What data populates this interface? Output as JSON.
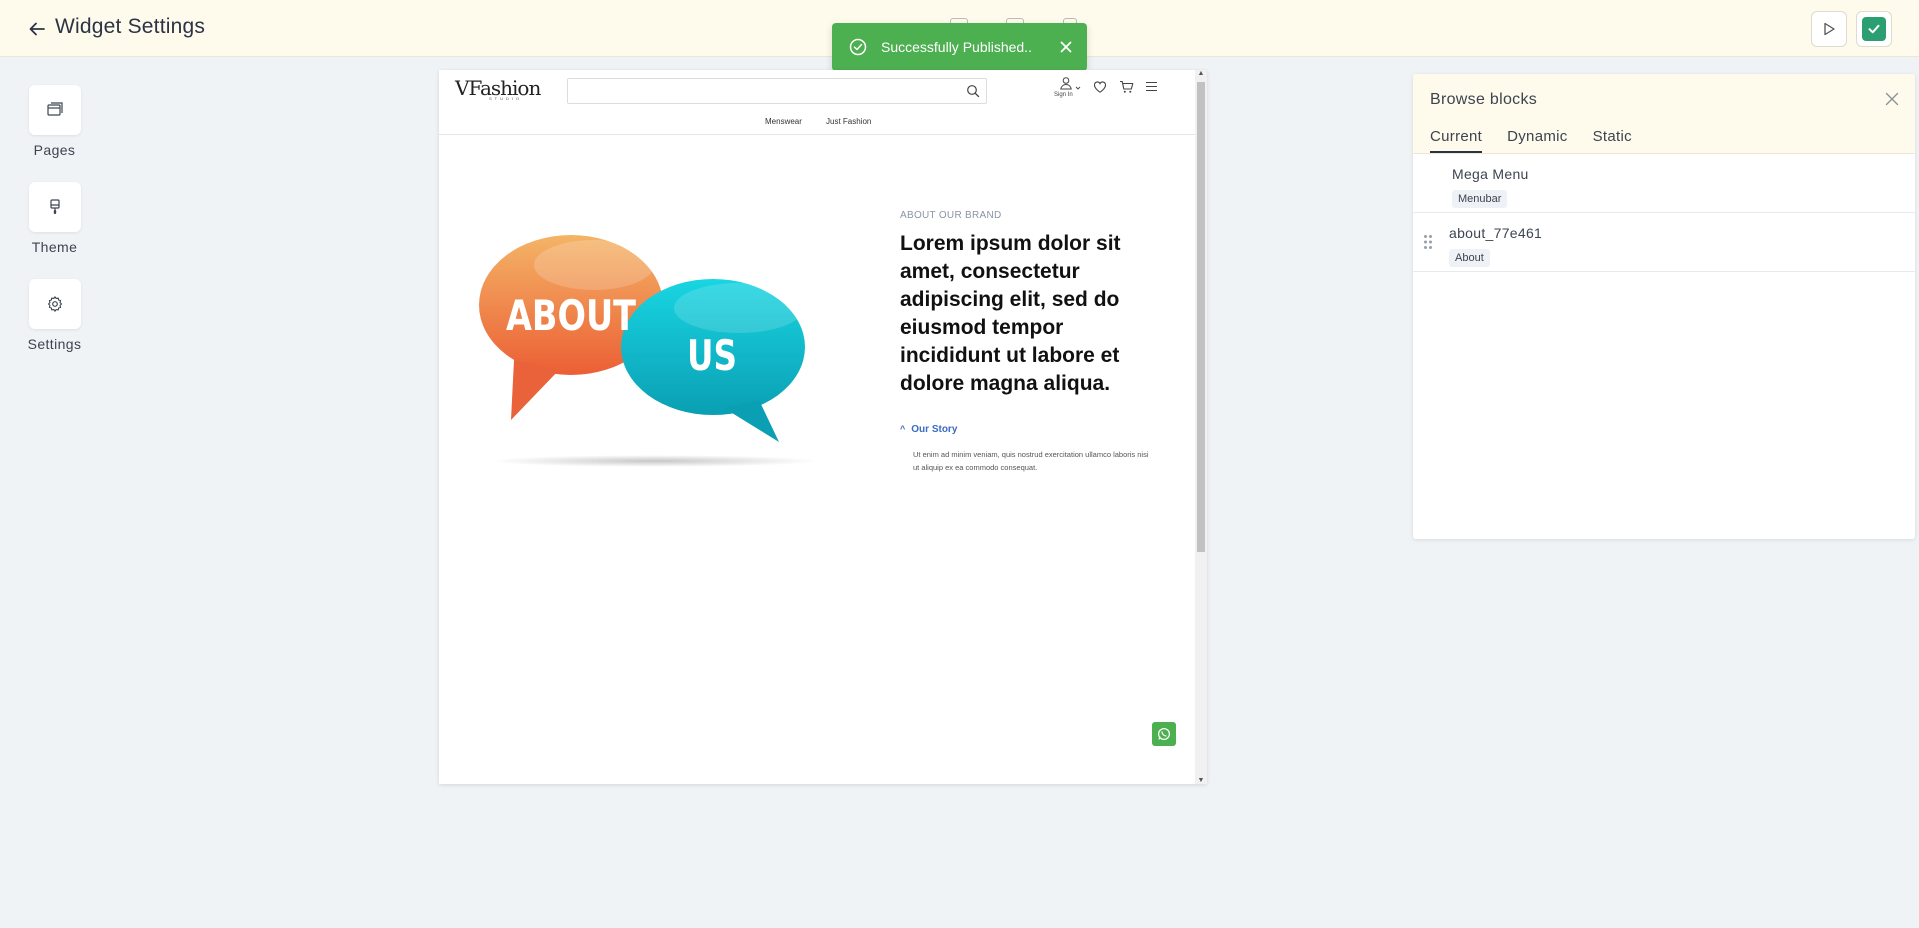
{
  "header": {
    "title": "Widget Settings"
  },
  "toast": {
    "message": "Successfully Published.."
  },
  "sidebar": {
    "items": [
      {
        "label": "Pages",
        "icon": "pages-icon"
      },
      {
        "label": "Theme",
        "icon": "brush-icon"
      },
      {
        "label": "Settings",
        "icon": "gear-icon"
      }
    ]
  },
  "preview": {
    "logo": "VFashion",
    "logo_sub": "STUDIO",
    "signin": "Sign In",
    "menu": [
      "Menswear",
      "Just Fashion"
    ],
    "about_image": {
      "word1": "ABOUT",
      "word2": "US"
    },
    "eyebrow": "ABOUT OUR BRAND",
    "heading": "Lorem ipsum dolor sit amet, consectetur adipiscing elit, sed do eiusmod tempor incididunt ut labore et dolore magna aliqua.",
    "story_title": "Our Story",
    "story_text": "Ut enim ad minim veniam, quis nostrud exercitation ullamco laboris nisi ut aliquip ex ea commodo consequat."
  },
  "panel": {
    "title": "Browse blocks",
    "tabs": [
      "Current",
      "Dynamic",
      "Static"
    ],
    "active_tab": "Current",
    "blocks": [
      {
        "name": "Mega Menu",
        "tag": "Menubar"
      },
      {
        "name": "about_77e461",
        "tag": "About"
      }
    ]
  },
  "colors": {
    "topbar_bg": "#fefaec",
    "toast_bg": "#4caf50",
    "publish_accent": "#2c9f72",
    "page_bg": "#f0f3f6"
  }
}
